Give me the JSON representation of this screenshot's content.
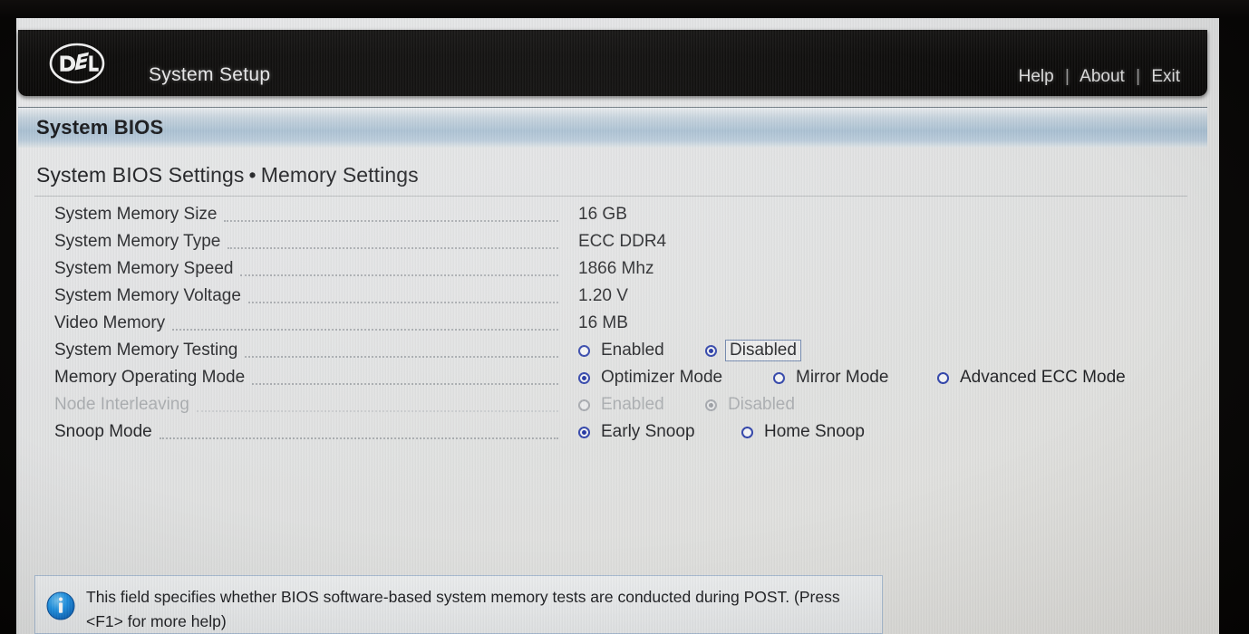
{
  "titlebar": {
    "logo_alt": "dell-logo",
    "app_title": "System Setup",
    "links": [
      {
        "name": "help",
        "label": "Help"
      },
      {
        "name": "about",
        "label": "About"
      },
      {
        "name": "exit",
        "label": "Exit"
      }
    ],
    "separator": "|"
  },
  "section": {
    "title": "System BIOS"
  },
  "breadcrumb": {
    "parent": "System BIOS Settings",
    "separator": "•",
    "current": "Memory Settings"
  },
  "rows": [
    {
      "name": "system-memory-size",
      "label": "System Memory Size",
      "type": "value",
      "value": "16 GB",
      "disabled": false
    },
    {
      "name": "system-memory-type",
      "label": "System Memory Type",
      "type": "value",
      "value": "ECC DDR4",
      "disabled": false
    },
    {
      "name": "system-memory-speed",
      "label": "System Memory Speed",
      "type": "value",
      "value": "1866 Mhz",
      "disabled": false
    },
    {
      "name": "system-memory-voltage",
      "label": "System Memory Voltage",
      "type": "value",
      "value": "1.20 V",
      "disabled": false
    },
    {
      "name": "video-memory",
      "label": "Video Memory",
      "type": "value",
      "value": "16 MB",
      "disabled": false
    },
    {
      "name": "system-memory-testing",
      "label": "System Memory Testing",
      "type": "radio",
      "disabled": false,
      "options": [
        {
          "label": "Enabled",
          "selected": false,
          "focused": false,
          "offset": 0
        },
        {
          "label": "Disabled",
          "selected": true,
          "focused": true,
          "offset": 140
        }
      ]
    },
    {
      "name": "memory-operating-mode",
      "label": "Memory Operating Mode",
      "type": "radio",
      "disabled": false,
      "options": [
        {
          "label": "Optimizer Mode",
          "selected": true,
          "focused": false,
          "offset": 0
        },
        {
          "label": "Mirror Mode",
          "selected": false,
          "focused": false,
          "offset": 215
        },
        {
          "label": "Advanced ECC Mode",
          "selected": false,
          "focused": false,
          "offset": 396
        }
      ]
    },
    {
      "name": "node-interleaving",
      "label": "Node Interleaving",
      "type": "radio",
      "disabled": true,
      "options": [
        {
          "label": "Enabled",
          "selected": false,
          "focused": false,
          "offset": 0
        },
        {
          "label": "Disabled",
          "selected": true,
          "focused": false,
          "offset": 140
        }
      ]
    },
    {
      "name": "snoop-mode",
      "label": "Snoop Mode",
      "type": "radio",
      "disabled": false,
      "options": [
        {
          "label": "Early Snoop",
          "selected": true,
          "focused": false,
          "offset": 0
        },
        {
          "label": "Home Snoop",
          "selected": false,
          "focused": false,
          "offset": 180
        }
      ]
    }
  ],
  "help": {
    "icon": "info-icon",
    "text": "This field specifies whether BIOS software-based system memory tests are conducted during POST. (Press <F1> for more help)"
  },
  "colors": {
    "page_bg": "#e2e3e4",
    "titlebar_bg": "#0d0c0b",
    "section_bar": "#a9c0d2",
    "radio_accent": "#1b2fa0",
    "info_icon": "#1f8fe0",
    "disabled_text": "#a9acaf"
  }
}
